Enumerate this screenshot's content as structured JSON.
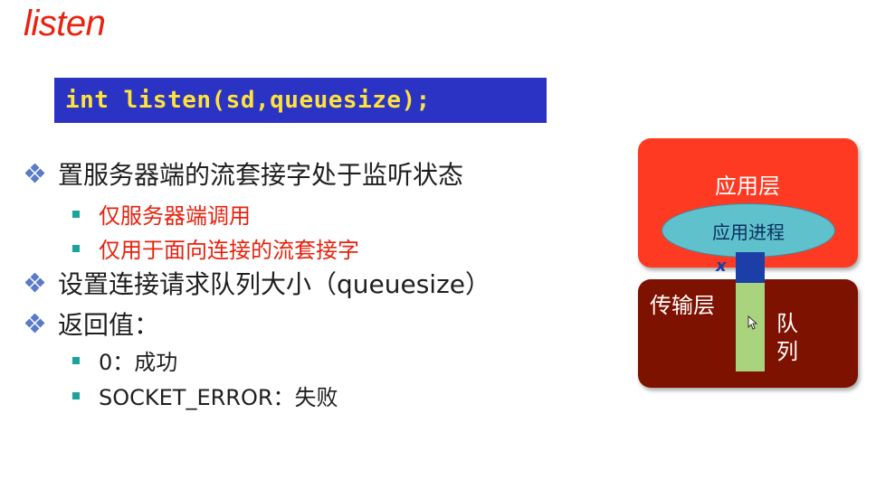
{
  "slide": {
    "title": "listen",
    "code": "int listen(sd,queuesize);",
    "bullets": [
      {
        "level": 1,
        "text": "置服务器端的流套接字处于监听状态"
      },
      {
        "level": 2,
        "text": "仅服务器端调用",
        "color": "#e8220e"
      },
      {
        "level": 2,
        "text": "仅用于面向连接的流套接字",
        "color": "#e8220e"
      },
      {
        "level": 1,
        "text": "设置连接请求队列大小（queuesize）"
      },
      {
        "level": 1,
        "text": "返回值："
      },
      {
        "level": 2,
        "text": "0：成功"
      },
      {
        "level": 2,
        "text": "SOCKET_ERROR：失败"
      }
    ]
  },
  "diagram": {
    "app_layer": "应用层",
    "app_process": "应用进程",
    "transport_layer": "传输层",
    "queue_label_1": "队",
    "queue_label_2": "列",
    "x_mark": "x"
  },
  "colors": {
    "title": "#e8220e",
    "code_bg": "#2a33c4",
    "code_text": "#ffe23c",
    "app_layer": "#ff3a22",
    "transport_layer": "#7d1200",
    "process": "#5fc1cb",
    "queue_head": "#1c3ea7",
    "queue_body": "#a9d37d",
    "bullet_accent": "#1aa39a"
  }
}
